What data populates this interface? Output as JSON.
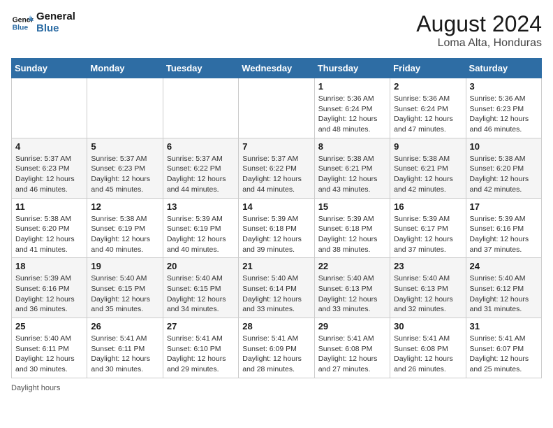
{
  "header": {
    "logo_line1": "General",
    "logo_line2": "Blue",
    "title": "August 2024",
    "subtitle": "Loma Alta, Honduras"
  },
  "footer": {
    "daylight_label": "Daylight hours"
  },
  "days_of_week": [
    "Sunday",
    "Monday",
    "Tuesday",
    "Wednesday",
    "Thursday",
    "Friday",
    "Saturday"
  ],
  "weeks": [
    [
      {
        "day": "",
        "info": ""
      },
      {
        "day": "",
        "info": ""
      },
      {
        "day": "",
        "info": ""
      },
      {
        "day": "",
        "info": ""
      },
      {
        "day": "1",
        "info": "Sunrise: 5:36 AM\nSunset: 6:24 PM\nDaylight: 12 hours\nand 48 minutes."
      },
      {
        "day": "2",
        "info": "Sunrise: 5:36 AM\nSunset: 6:24 PM\nDaylight: 12 hours\nand 47 minutes."
      },
      {
        "day": "3",
        "info": "Sunrise: 5:36 AM\nSunset: 6:23 PM\nDaylight: 12 hours\nand 46 minutes."
      }
    ],
    [
      {
        "day": "4",
        "info": "Sunrise: 5:37 AM\nSunset: 6:23 PM\nDaylight: 12 hours\nand 46 minutes."
      },
      {
        "day": "5",
        "info": "Sunrise: 5:37 AM\nSunset: 6:23 PM\nDaylight: 12 hours\nand 45 minutes."
      },
      {
        "day": "6",
        "info": "Sunrise: 5:37 AM\nSunset: 6:22 PM\nDaylight: 12 hours\nand 44 minutes."
      },
      {
        "day": "7",
        "info": "Sunrise: 5:37 AM\nSunset: 6:22 PM\nDaylight: 12 hours\nand 44 minutes."
      },
      {
        "day": "8",
        "info": "Sunrise: 5:38 AM\nSunset: 6:21 PM\nDaylight: 12 hours\nand 43 minutes."
      },
      {
        "day": "9",
        "info": "Sunrise: 5:38 AM\nSunset: 6:21 PM\nDaylight: 12 hours\nand 42 minutes."
      },
      {
        "day": "10",
        "info": "Sunrise: 5:38 AM\nSunset: 6:20 PM\nDaylight: 12 hours\nand 42 minutes."
      }
    ],
    [
      {
        "day": "11",
        "info": "Sunrise: 5:38 AM\nSunset: 6:20 PM\nDaylight: 12 hours\nand 41 minutes."
      },
      {
        "day": "12",
        "info": "Sunrise: 5:38 AM\nSunset: 6:19 PM\nDaylight: 12 hours\nand 40 minutes."
      },
      {
        "day": "13",
        "info": "Sunrise: 5:39 AM\nSunset: 6:19 PM\nDaylight: 12 hours\nand 40 minutes."
      },
      {
        "day": "14",
        "info": "Sunrise: 5:39 AM\nSunset: 6:18 PM\nDaylight: 12 hours\nand 39 minutes."
      },
      {
        "day": "15",
        "info": "Sunrise: 5:39 AM\nSunset: 6:18 PM\nDaylight: 12 hours\nand 38 minutes."
      },
      {
        "day": "16",
        "info": "Sunrise: 5:39 AM\nSunset: 6:17 PM\nDaylight: 12 hours\nand 37 minutes."
      },
      {
        "day": "17",
        "info": "Sunrise: 5:39 AM\nSunset: 6:16 PM\nDaylight: 12 hours\nand 37 minutes."
      }
    ],
    [
      {
        "day": "18",
        "info": "Sunrise: 5:39 AM\nSunset: 6:16 PM\nDaylight: 12 hours\nand 36 minutes."
      },
      {
        "day": "19",
        "info": "Sunrise: 5:40 AM\nSunset: 6:15 PM\nDaylight: 12 hours\nand 35 minutes."
      },
      {
        "day": "20",
        "info": "Sunrise: 5:40 AM\nSunset: 6:15 PM\nDaylight: 12 hours\nand 34 minutes."
      },
      {
        "day": "21",
        "info": "Sunrise: 5:40 AM\nSunset: 6:14 PM\nDaylight: 12 hours\nand 33 minutes."
      },
      {
        "day": "22",
        "info": "Sunrise: 5:40 AM\nSunset: 6:13 PM\nDaylight: 12 hours\nand 33 minutes."
      },
      {
        "day": "23",
        "info": "Sunrise: 5:40 AM\nSunset: 6:13 PM\nDaylight: 12 hours\nand 32 minutes."
      },
      {
        "day": "24",
        "info": "Sunrise: 5:40 AM\nSunset: 6:12 PM\nDaylight: 12 hours\nand 31 minutes."
      }
    ],
    [
      {
        "day": "25",
        "info": "Sunrise: 5:40 AM\nSunset: 6:11 PM\nDaylight: 12 hours\nand 30 minutes."
      },
      {
        "day": "26",
        "info": "Sunrise: 5:41 AM\nSunset: 6:11 PM\nDaylight: 12 hours\nand 30 minutes."
      },
      {
        "day": "27",
        "info": "Sunrise: 5:41 AM\nSunset: 6:10 PM\nDaylight: 12 hours\nand 29 minutes."
      },
      {
        "day": "28",
        "info": "Sunrise: 5:41 AM\nSunset: 6:09 PM\nDaylight: 12 hours\nand 28 minutes."
      },
      {
        "day": "29",
        "info": "Sunrise: 5:41 AM\nSunset: 6:08 PM\nDaylight: 12 hours\nand 27 minutes."
      },
      {
        "day": "30",
        "info": "Sunrise: 5:41 AM\nSunset: 6:08 PM\nDaylight: 12 hours\nand 26 minutes."
      },
      {
        "day": "31",
        "info": "Sunrise: 5:41 AM\nSunset: 6:07 PM\nDaylight: 12 hours\nand 25 minutes."
      }
    ]
  ]
}
